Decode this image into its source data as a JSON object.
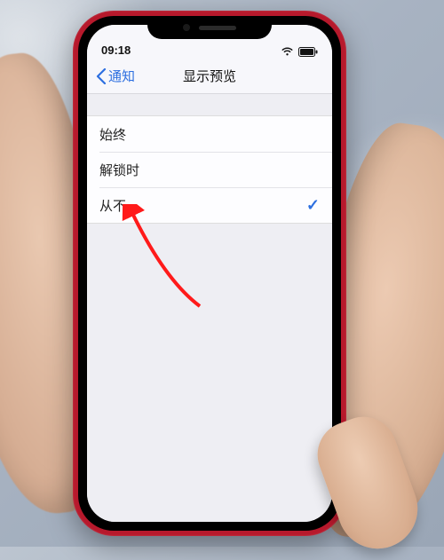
{
  "statusbar": {
    "time": "09:18"
  },
  "navbar": {
    "back_label": "通知",
    "title": "显示预览"
  },
  "options": {
    "items": [
      {
        "label": "始终",
        "selected": false
      },
      {
        "label": "解锁时",
        "selected": false
      },
      {
        "label": "从不",
        "selected": true
      }
    ],
    "checkmark": "✓"
  },
  "colors": {
    "ios_blue": "#2d6fe0",
    "annotation_red": "#ff1a1a"
  }
}
